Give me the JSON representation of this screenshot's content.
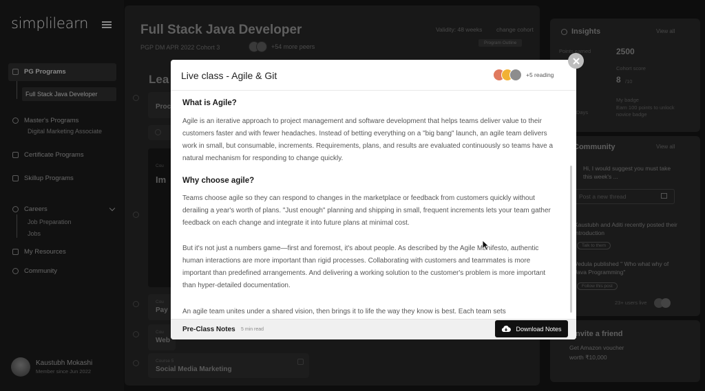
{
  "sidebar": {
    "logo": "simplilearn",
    "items": [
      {
        "label": "PG Programs"
      },
      {
        "label": "Full Stack Java Developer"
      },
      {
        "label": "Master's Programs"
      },
      {
        "label": "Digital Marketing Associate"
      },
      {
        "label": "Certificate Programs"
      },
      {
        "label": "Skillup Programs"
      },
      {
        "label": "Careers"
      },
      {
        "label": "Job Preparation"
      },
      {
        "label": "Jobs"
      },
      {
        "label": "My Resources"
      },
      {
        "label": "Community"
      }
    ],
    "user": {
      "name": "Kaustubh Mokashi",
      "subtitle": "Member since Jun 2022"
    }
  },
  "main": {
    "title": "Full Stack Java Developer",
    "cohort": "PGP DM APR 2022 Cohort 3",
    "peers": "+54 more peers",
    "validity": "Validity: 48 weeks",
    "change_cohort": "change cohort",
    "program_outline": "Program Outline",
    "section_heading": "Lea",
    "cards": [
      {
        "small": "",
        "title": "Proc"
      },
      {
        "small": "Cou",
        "title": "Im"
      },
      {
        "small": "Cou",
        "title": "Pay"
      },
      {
        "small": "Cou",
        "title": "Web"
      },
      {
        "small": "Course 5",
        "title": "Social Media Marketing"
      }
    ]
  },
  "insights": {
    "title": "Insights",
    "view_all": "View all",
    "stats": [
      {
        "label": "Points earned",
        "value": "2500"
      },
      {
        "label": "Cohort score",
        "value": "8",
        "suffix": "/10"
      },
      {
        "label": "",
        "value": "Days"
      },
      {
        "label": "My badge",
        "value": "Earn 100 points to unlock novice badge"
      }
    ]
  },
  "community": {
    "title": "Community",
    "view_all": "View all",
    "message": "Hi, I would suggest you must take this week's ...",
    "thread_placeholder": "Post a new thread",
    "activity_1": "Kaustubh and Aditi recently posted their introduction",
    "activity_1_pill": "Talk to them",
    "activity_2": "Vedula published \" Who what why of Java Programming\"",
    "activity_2_pill": "Follow this post",
    "users_live": "23+ users live"
  },
  "invite": {
    "title": "Invite a friend",
    "line1": "Get Amazon voucher",
    "line2": "worth ₹10,000"
  },
  "modal": {
    "title": "Live class - Agile & Git",
    "reading": "+5 reading",
    "sections": [
      {
        "heading": "What is Agile?",
        "paragraphs": [
          "Agile is an iterative approach to project management and software development that helps teams deliver value to their customers faster and with fewer headaches. Instead of betting everything on a \"big bang\" launch, an agile team delivers work in small, but consumable, increments. Requirements, plans, and results are evaluated continuously so teams have a natural mechanism for responding to change quickly."
        ]
      },
      {
        "heading": "Why choose agile?",
        "paragraphs": [
          "Teams choose agile so they can respond to changes in the marketplace or feedback from customers quickly without derailing a year's worth of plans. \"Just enough\" planning and shipping in small, frequent increments lets your team gather feedback on each change and integrate it into future plans at minimal cost.",
          "But it's not just a numbers game—first and foremost, it's about people. As described by the Agile Manifesto, authentic human interactions are more important than rigid processes. Collaborating with customers and teammates is more important than predefined arrangements. And delivering a working solution to the customer's problem is more important than hyper-detailed documentation.",
          "An agile team unites under a shared vision, then brings it to life the way they know is best. Each team sets"
        ]
      }
    ],
    "footer_title": "Pre-Class Notes",
    "footer_sub": "5 min read",
    "download_label": "Download Notes"
  }
}
